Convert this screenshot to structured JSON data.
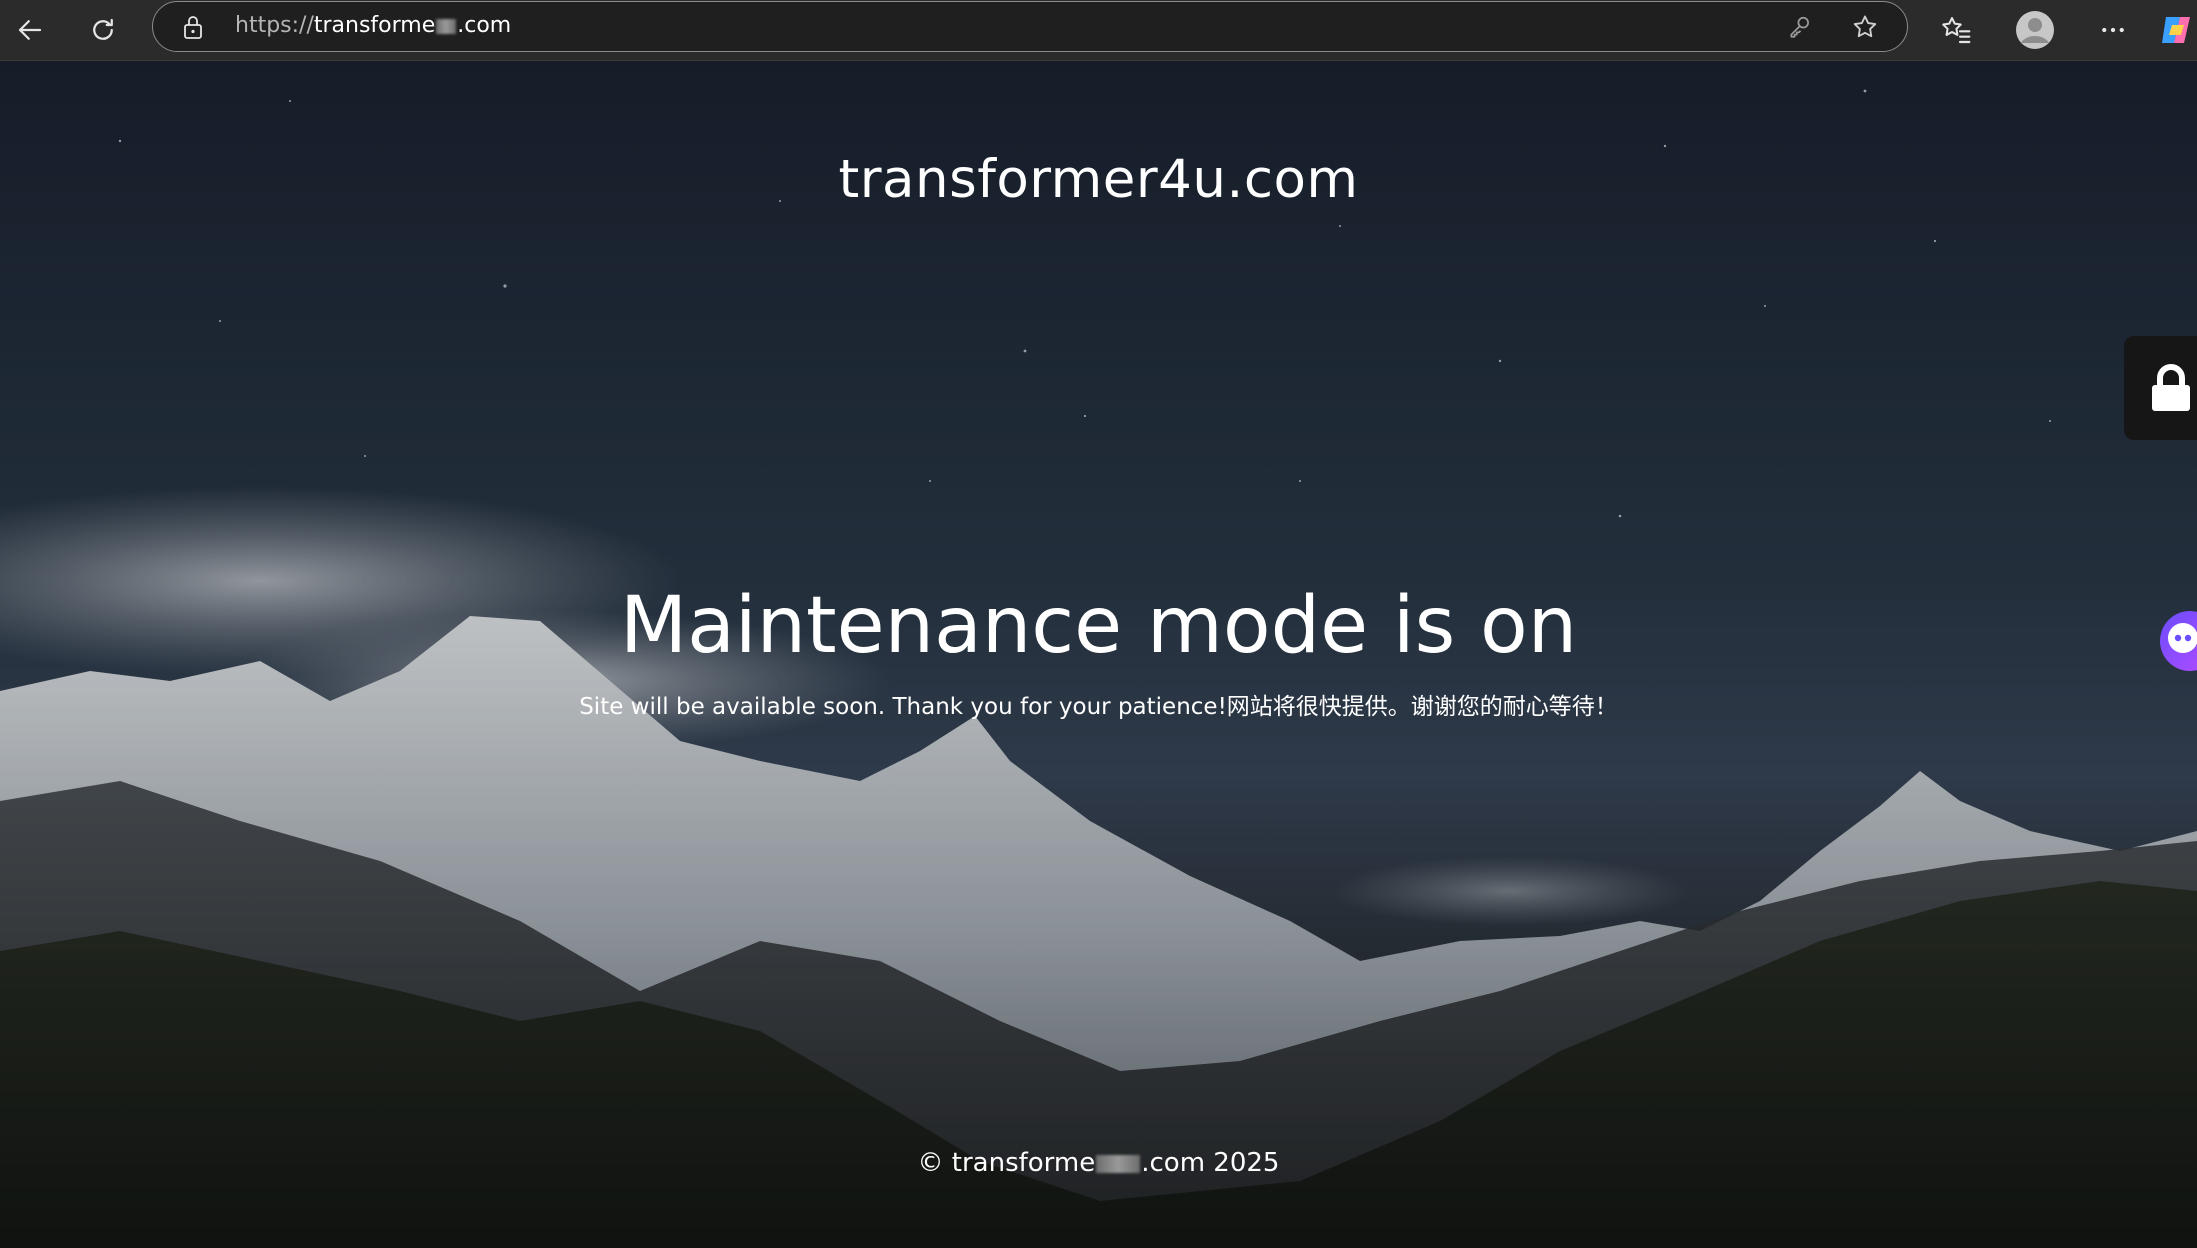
{
  "browser": {
    "url_scheme": "https://",
    "url_host_start": "transforme",
    "url_host_end": ".com",
    "icons": {
      "back": "back-arrow-icon",
      "refresh": "refresh-icon",
      "site_info": "lock-icon",
      "passwords": "key-icon",
      "favorite": "star-icon",
      "favorites_menu": "favorites-icon",
      "profile": "profile-avatar-icon",
      "more": "more-dots-icon",
      "copilot": "copilot-icon"
    }
  },
  "page": {
    "site_title": "transformer4u.com",
    "headline": "Maintenance mode is on",
    "message": "Site will be available soon. Thank you for your patience!网站将很快提供。谢谢您的耐心等待！",
    "footer_prefix": "© transforme",
    "footer_suffix": ".com 2025",
    "side_widgets": {
      "lock": "lock-icon",
      "chat": "chat-bot-icon"
    }
  }
}
